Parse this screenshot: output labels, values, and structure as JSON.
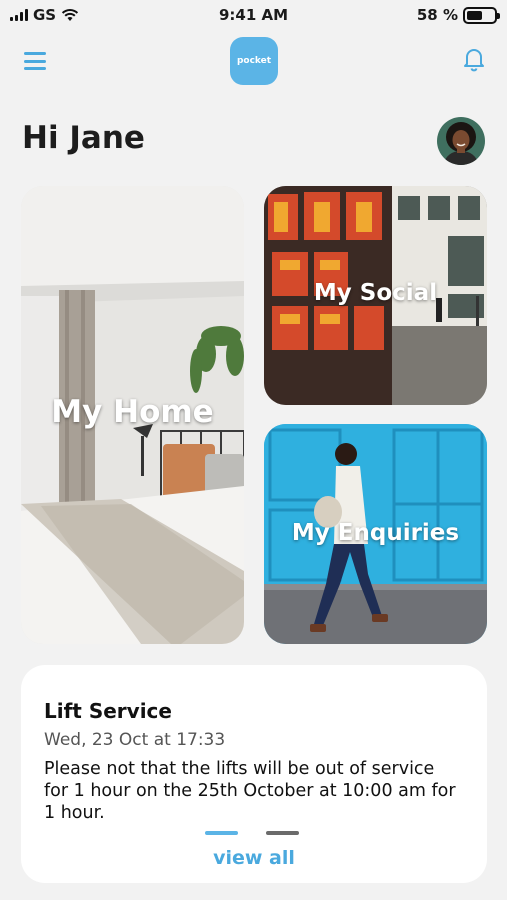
{
  "status_bar": {
    "carrier": "GS",
    "time": "9:41 AM",
    "battery_label": "58 %",
    "battery_level": 0.58
  },
  "header": {
    "logo_text": "pocket",
    "menu_icon": "hamburger-menu-icon",
    "notification_icon": "bell-icon"
  },
  "greeting": "Hi Jane",
  "tiles": [
    {
      "label": "My Home"
    },
    {
      "label": "My Social"
    },
    {
      "label": "My Enquiries"
    }
  ],
  "notice": {
    "title": "Lift Service",
    "date": "Wed, 23 Oct at 17:33",
    "body": "Please not that the lifts will be out of service for 1 hour on the 25th October at 10:00 am for 1 hour.",
    "active_page": 1,
    "total_pages": 2,
    "view_all_label": "view all"
  },
  "colors": {
    "accent": "#4aa9de",
    "logo_bg": "#5bb4e6",
    "background": "#f2f2f2",
    "pager_active": "#5bb4e6",
    "pager_inactive": "#6b6b6b"
  }
}
